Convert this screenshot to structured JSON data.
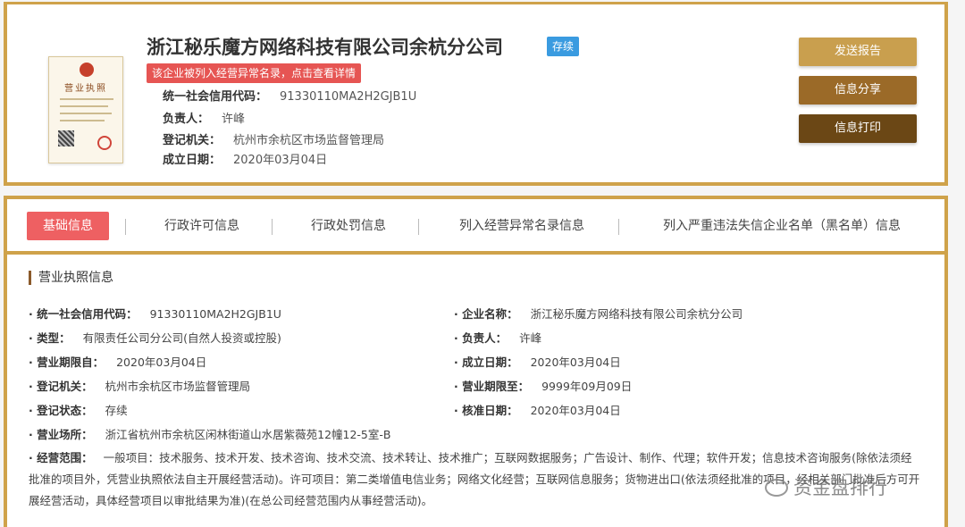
{
  "company": {
    "name": "浙江秘乐魔方网络科技有限公司余杭分公司",
    "status": "存续",
    "abnormal_notice": "该企业被列入经营异常名录，点击查看详情",
    "license_title": "营业执照"
  },
  "top_info": [
    {
      "label": "统一社会信用代码：",
      "value": "91330110MA2H2GJB1U"
    },
    {
      "label": "负责人：",
      "value": "许峰"
    },
    {
      "label": "登记机关：",
      "value": "杭州市余杭区市场监督管理局"
    },
    {
      "label": "成立日期：",
      "value": "2020年03月04日"
    }
  ],
  "actions": {
    "send_report": "发送报告",
    "share_info": "信息分享",
    "print_info": "信息打印"
  },
  "tabs": [
    {
      "label": "基础信息"
    },
    {
      "label": "行政许可信息"
    },
    {
      "label": "行政处罚信息"
    },
    {
      "label": "列入经营异常名录信息"
    },
    {
      "label": "列入严重违法失信企业名单（黑名单）信息"
    }
  ],
  "section": {
    "title": "营业执照信息",
    "left": [
      {
        "label": "· 统一社会信用代码：",
        "value": "91330110MA2H2GJB1U"
      },
      {
        "label": "· 类型：",
        "value": "有限责任公司分公司(自然人投资或控股)"
      },
      {
        "label": "· 营业期限自：",
        "value": "2020年03月04日"
      },
      {
        "label": "· 登记机关：",
        "value": "杭州市余杭区市场监督管理局"
      },
      {
        "label": "· 登记状态：",
        "value": "存续"
      },
      {
        "label": "· 营业场所：",
        "value": "浙江省杭州市余杭区闲林街道山水居紫薇苑12幢12-5室-B"
      }
    ],
    "right": [
      {
        "label": "· 企业名称：",
        "value": "浙江秘乐魔方网络科技有限公司余杭分公司"
      },
      {
        "label": "· 负责人：",
        "value": "许峰"
      },
      {
        "label": "· 成立日期：",
        "value": "2020年03月04日"
      },
      {
        "label": "· 营业期限至：",
        "value": "9999年09月09日"
      },
      {
        "label": "· 核准日期：",
        "value": "2020年03月04日"
      }
    ],
    "scope": {
      "label": "· 经营范围：",
      "value": "一般项目：技术服务、技术开发、技术咨询、技术交流、技术转让、技术推广；互联网数据服务；广告设计、制作、代理；软件开发；信息技术咨询服务(除依法须经批准的项目外，凭营业执照依法自主开展经营活动)。许可项目：第二类增值电信业务；网络文化经营；互联网信息服务；货物进出口(依法须经批准的项目，经相关部门批准后方可开展经营活动，具体经营项目以审批结果为准)(在总公司经营范围内从事经营活动)。"
    }
  },
  "watermark": "资金盘排行"
}
